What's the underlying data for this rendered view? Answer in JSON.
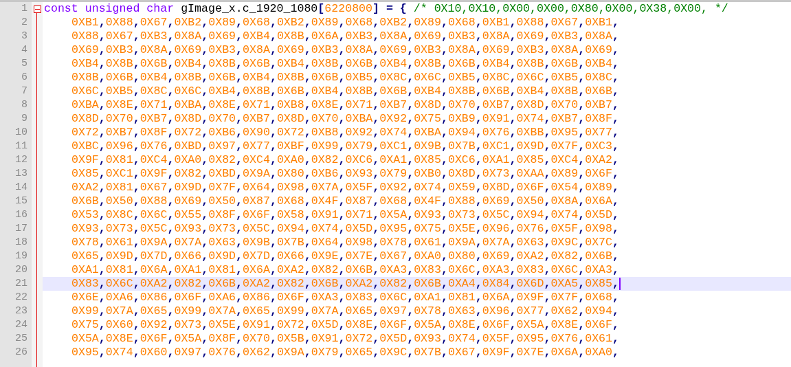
{
  "editor": {
    "lines": [
      {
        "number": "1",
        "kind": "declaration",
        "fold": {
          "expanded": true
        },
        "current": false,
        "tokens": [
          {
            "kind": "keyword",
            "text": "const unsigned char"
          },
          {
            "kind": "identifier",
            "text": " gImage_x.c_1920_1080"
          },
          {
            "kind": "operator",
            "text": "["
          },
          {
            "kind": "number",
            "text": "6220800"
          },
          {
            "kind": "operator",
            "text": "] = {"
          },
          {
            "kind": "comment",
            "text": " /* 0X10,0X10,0X00,0X00,0X80,0X00,0X38,0X00, */"
          }
        ]
      },
      {
        "number": "2",
        "kind": "data",
        "current": false,
        "text": "0XB1,0X88,0X67,0XB2,0X89,0X68,0XB2,0X89,0X68,0XB2,0X89,0X68,0XB1,0X88,0X67,0XB1,"
      },
      {
        "number": "3",
        "kind": "data",
        "current": false,
        "text": "0X88,0X67,0XB3,0X8A,0X69,0XB4,0X8B,0X6A,0XB3,0X8A,0X69,0XB3,0X8A,0X69,0XB3,0X8A,"
      },
      {
        "number": "4",
        "kind": "data",
        "current": false,
        "text": "0X69,0XB3,0X8A,0X69,0XB3,0X8A,0X69,0XB3,0X8A,0X69,0XB3,0X8A,0X69,0XB3,0X8A,0X69,"
      },
      {
        "number": "5",
        "kind": "data",
        "current": false,
        "text": "0XB4,0X8B,0X6B,0XB4,0X8B,0X6B,0XB4,0X8B,0X6B,0XB4,0X8B,0X6B,0XB4,0X8B,0X6B,0XB4,"
      },
      {
        "number": "6",
        "kind": "data",
        "current": false,
        "text": "0X8B,0X6B,0XB4,0X8B,0X6B,0XB4,0X8B,0X6B,0XB5,0X8C,0X6C,0XB5,0X8C,0X6C,0XB5,0X8C,"
      },
      {
        "number": "7",
        "kind": "data",
        "current": false,
        "text": "0X6C,0XB5,0X8C,0X6C,0XB4,0X8B,0X6B,0XB4,0X8B,0X6B,0XB4,0X8B,0X6B,0XB4,0X8B,0X6B,"
      },
      {
        "number": "8",
        "kind": "data",
        "current": false,
        "text": "0XBA,0X8E,0X71,0XBA,0X8E,0X71,0XB8,0X8E,0X71,0XB7,0X8D,0X70,0XB7,0X8D,0X70,0XB7,"
      },
      {
        "number": "9",
        "kind": "data",
        "current": false,
        "text": "0X8D,0X70,0XB7,0X8D,0X70,0XB7,0X8D,0X70,0XBA,0X92,0X75,0XB9,0X91,0X74,0XB7,0X8F,"
      },
      {
        "number": "10",
        "kind": "data",
        "current": false,
        "text": "0X72,0XB7,0X8F,0X72,0XB6,0X90,0X72,0XB8,0X92,0X74,0XBA,0X94,0X76,0XBB,0X95,0X77,"
      },
      {
        "number": "11",
        "kind": "data",
        "current": false,
        "text": "0XBC,0X96,0X76,0XBD,0X97,0X77,0XBF,0X99,0X79,0XC1,0X9B,0X7B,0XC1,0X9D,0X7F,0XC3,"
      },
      {
        "number": "12",
        "kind": "data",
        "current": false,
        "text": "0X9F,0X81,0XC4,0XA0,0X82,0XC4,0XA0,0X82,0XC6,0XA1,0X85,0XC6,0XA1,0X85,0XC4,0XA2,"
      },
      {
        "number": "13",
        "kind": "data",
        "current": false,
        "text": "0X85,0XC1,0X9F,0X82,0XBD,0X9A,0X80,0XB6,0X93,0X79,0XB0,0X8D,0X73,0XAA,0X89,0X6F,"
      },
      {
        "number": "14",
        "kind": "data",
        "current": false,
        "text": "0XA2,0X81,0X67,0X9D,0X7F,0X64,0X98,0X7A,0X5F,0X92,0X74,0X59,0X8D,0X6F,0X54,0X89,"
      },
      {
        "number": "15",
        "kind": "data",
        "current": false,
        "text": "0X6B,0X50,0X88,0X69,0X50,0X87,0X68,0X4F,0X87,0X68,0X4F,0X88,0X69,0X50,0X8A,0X6A,"
      },
      {
        "number": "16",
        "kind": "data",
        "current": false,
        "text": "0X53,0X8C,0X6C,0X55,0X8F,0X6F,0X58,0X91,0X71,0X5A,0X93,0X73,0X5C,0X94,0X74,0X5D,"
      },
      {
        "number": "17",
        "kind": "data",
        "current": false,
        "text": "0X93,0X73,0X5C,0X93,0X73,0X5C,0X94,0X74,0X5D,0X95,0X75,0X5E,0X96,0X76,0X5F,0X98,"
      },
      {
        "number": "18",
        "kind": "data",
        "current": false,
        "text": "0X78,0X61,0X9A,0X7A,0X63,0X9B,0X7B,0X64,0X98,0X78,0X61,0X9A,0X7A,0X63,0X9C,0X7C,"
      },
      {
        "number": "19",
        "kind": "data",
        "current": false,
        "text": "0X65,0X9D,0X7D,0X66,0X9D,0X7D,0X66,0X9E,0X7E,0X67,0XA0,0X80,0X69,0XA2,0X82,0X6B,"
      },
      {
        "number": "20",
        "kind": "data",
        "current": false,
        "text": "0XA1,0X81,0X6A,0XA1,0X81,0X6A,0XA2,0X82,0X6B,0XA3,0X83,0X6C,0XA3,0X83,0X6C,0XA3,"
      },
      {
        "number": "21",
        "kind": "data",
        "current": true,
        "text": "0X83,0X6C,0XA2,0X82,0X6B,0XA2,0X82,0X6B,0XA2,0X82,0X6B,0XA4,0X84,0X6D,0XA5,0X85,"
      },
      {
        "number": "22",
        "kind": "data",
        "current": false,
        "text": "0X6E,0XA6,0X86,0X6F,0XA6,0X86,0X6F,0XA3,0X83,0X6C,0XA1,0X81,0X6A,0X9F,0X7F,0X68,"
      },
      {
        "number": "23",
        "kind": "data",
        "current": false,
        "text": "0X99,0X7A,0X65,0X99,0X7A,0X65,0X99,0X7A,0X65,0X97,0X78,0X63,0X96,0X77,0X62,0X94,"
      },
      {
        "number": "24",
        "kind": "data",
        "current": false,
        "text": "0X75,0X60,0X92,0X73,0X5E,0X91,0X72,0X5D,0X8E,0X6F,0X5A,0X8E,0X6F,0X5A,0X8E,0X6F,"
      },
      {
        "number": "25",
        "kind": "data",
        "current": false,
        "text": "0X5A,0X8E,0X6F,0X5A,0X8F,0X70,0X5B,0X91,0X72,0X5D,0X93,0X74,0X5F,0X95,0X76,0X61,"
      },
      {
        "number": "26",
        "kind": "data",
        "current": false,
        "text": "0X95,0X74,0X60,0X97,0X76,0X62,0X9A,0X79,0X65,0X9C,0X7B,0X67,0X9F,0X7E,0X6A,0XA0,"
      }
    ]
  }
}
